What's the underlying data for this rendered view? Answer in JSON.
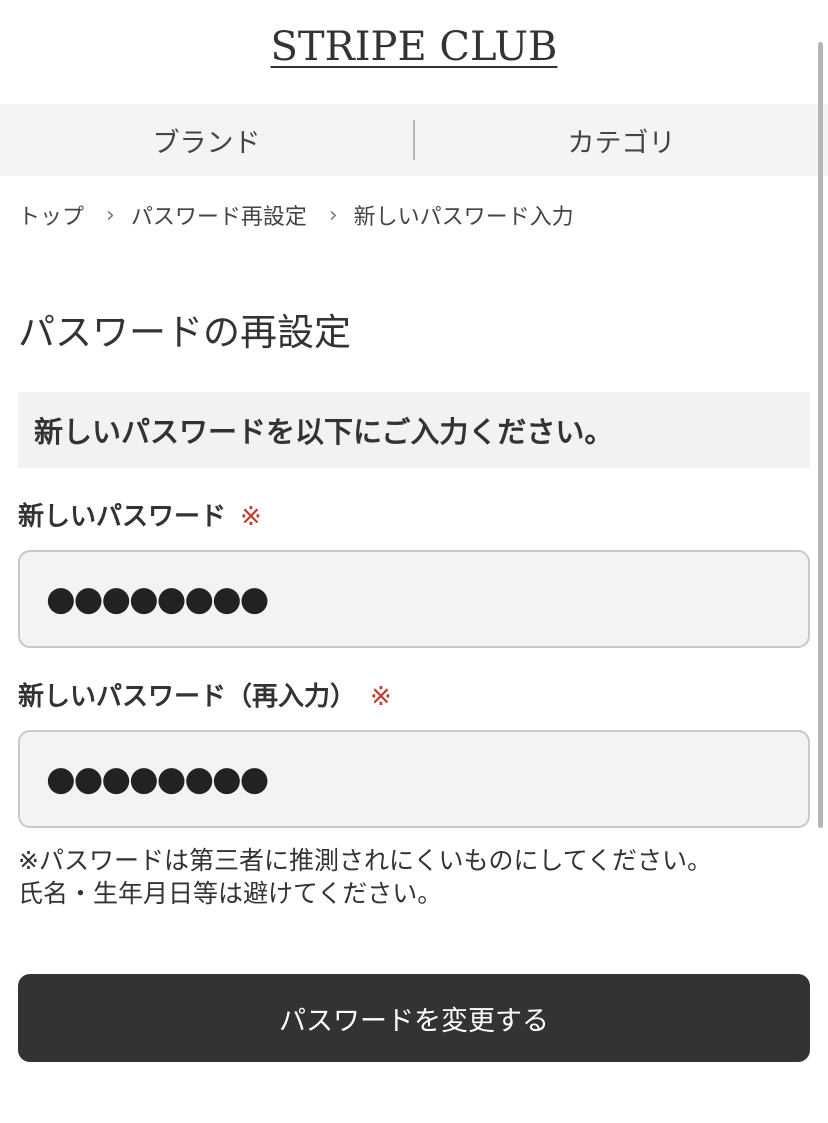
{
  "header": {
    "logo": "STRIPE CLUB"
  },
  "nav": {
    "items": [
      {
        "label": "ブランド"
      },
      {
        "label": "カテゴリ"
      }
    ]
  },
  "breadcrumb": {
    "items": [
      {
        "label": "トップ"
      },
      {
        "label": "パスワード再設定"
      }
    ],
    "separator": "›",
    "current": "新しいパスワード入力"
  },
  "main": {
    "title": "パスワードの再設定",
    "instruction": "新しいパスワードを以下にご入力ください。",
    "fields": [
      {
        "label": "新しいパスワード",
        "required_mark": "※",
        "value": "●●●●●●●●"
      },
      {
        "label": "新しいパスワード（再入力）",
        "required_mark": "※",
        "value": "●●●●●●●●"
      }
    ],
    "note_lines": [
      "※パスワードは第三者に推測されにくいものにしてください。",
      "氏名・生年月日等は避けてください。"
    ],
    "submit_label": "パスワードを変更する"
  },
  "colors": {
    "required": "#c0392b",
    "button_bg": "#333333",
    "nav_bg": "#f4f4f4"
  }
}
